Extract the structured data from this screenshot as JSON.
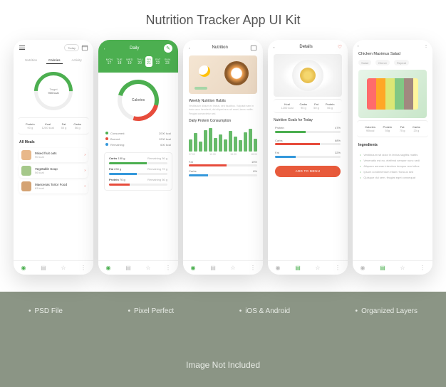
{
  "title": "Nutrition Tracker App UI Kit",
  "features": [
    "PSD File",
    "Pixel Perfect",
    "iOS & Android",
    "Organized Layers"
  ],
  "footer": "Image Not Included",
  "colors": {
    "green": "#4CAF50",
    "red": "#e74c3c",
    "blue": "#3498db",
    "orange": "#e85a3b"
  },
  "s1": {
    "today": "Today",
    "tab1": "Nutrition",
    "tab2": "Calories",
    "tab3": "Activity",
    "target_label": "Target",
    "target_value": "900 kcal",
    "stats": [
      {
        "label": "Protein",
        "value": "90 g"
      },
      {
        "label": "Kcal",
        "value": "1200 kcal"
      },
      {
        "label": "Fat",
        "value": "50 g"
      },
      {
        "label": "Carbs",
        "value": "56 g"
      }
    ],
    "meals_title": "All Meals",
    "meals": [
      {
        "name": "Mixed fruit oats",
        "cal": "90 kcal"
      },
      {
        "name": "Vegetable Soup",
        "cal": "56 kcal"
      },
      {
        "name": "Maecenas Tortor Food",
        "cal": "83 kcal"
      }
    ]
  },
  "s2": {
    "title": "Daily",
    "days": [
      {
        "d": "MON",
        "n": "17"
      },
      {
        "d": "TUE",
        "n": "18"
      },
      {
        "d": "WED",
        "n": "19"
      },
      {
        "d": "THU",
        "n": "20"
      },
      {
        "d": "FRI",
        "n": "21"
      },
      {
        "d": "SAT",
        "n": "22"
      },
      {
        "d": "SUN",
        "n": "23"
      }
    ],
    "ring_label": "Calories",
    "legend": [
      {
        "label": "Consumed:",
        "value": "2000 kcal"
      },
      {
        "label": "Burned:",
        "value": "1200 kcal"
      },
      {
        "label": "Remaining:",
        "value": "600 kcal"
      }
    ],
    "remaining_label": "Remaining",
    "nut": [
      {
        "name": "Carbs",
        "amount": "150 g",
        "remaining": "56 g"
      },
      {
        "name": "Fat",
        "amount": "230 g",
        "remaining": "72 g"
      },
      {
        "name": "Protein",
        "amount": "70 g",
        "remaining": "56 g"
      }
    ]
  },
  "s3": {
    "title": "Nutrition",
    "sub1": "Weekly Nutrition Habits",
    "desc": "Vestibulum dictum ex lectus, sed faucibus. Vulputat nam in tortor arcu hendrerit, dui aliquet arcu sit amet, lacus mollis. Feugiat consectetur sed.",
    "sub2": "Daily Protein Consumption",
    "xticks": [
      "07.00",
      "12.00",
      "15.00",
      "18.00"
    ],
    "macros": [
      {
        "label": "Fat",
        "pct": "15%"
      },
      {
        "label": "Carbs",
        "pct": "8%"
      }
    ]
  },
  "s4": {
    "title": "Details",
    "stats": [
      {
        "label": "Kcal",
        "value": "1200 kcal"
      },
      {
        "label": "Carbs",
        "value": "90 g"
      },
      {
        "label": "Fat",
        "value": "50 g"
      },
      {
        "label": "Protein",
        "value": "56 g"
      }
    ],
    "goals_title": "Nutrition Goals for Today",
    "goals": [
      {
        "label": "Protein",
        "pct": "47%"
      },
      {
        "label": "Carbs",
        "pct": "68%"
      },
      {
        "label": "Fat",
        "pct": "32%"
      }
    ],
    "add_btn": "ADD TO MENU"
  },
  "s5": {
    "title": "Chicken Maximus Salad",
    "tabs": [
      "Salad",
      "Dinner",
      "Repeat"
    ],
    "stats": [
      {
        "label": "Calories",
        "value": "90kcal"
      },
      {
        "label": "Protein",
        "value": "50g"
      },
      {
        "label": "Fat",
        "value": "75 g"
      },
      {
        "label": "Carbs",
        "value": "20 g"
      }
    ],
    "ing_title": "Ingredients",
    "ingredients": [
      "Vestibulum sit dolor in lectus sagittis mattis",
      "Venenatis est eu, eleifend semper nunc sedi",
      "Aliquam aenean interdum tempus non tellus",
      "Ipsum condimentum etiam rhoncus sed",
      "Quisque dui sem, feugiat eget consequat"
    ]
  },
  "chart_data": {
    "type": "bar",
    "title": "Daily Protein Consumption",
    "xlabel": "Time",
    "ylabel": "Protein",
    "categories": [
      "07.00",
      "",
      "",
      "",
      "12.00",
      "",
      "",
      "",
      "15.00",
      "",
      "",
      "",
      "18.00",
      ""
    ],
    "values": [
      50,
      75,
      40,
      88,
      95,
      55,
      70,
      48,
      85,
      60,
      45,
      78,
      92,
      52
    ],
    "ylim": [
      0,
      100
    ]
  }
}
